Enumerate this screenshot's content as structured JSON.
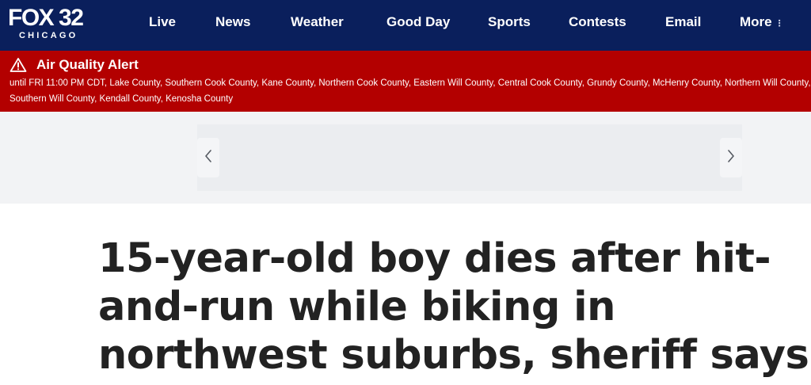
{
  "header": {
    "logo": {
      "main": "FOX 32",
      "sub": "CHICAGO"
    },
    "nav": [
      {
        "label": "Live"
      },
      {
        "label": "News"
      },
      {
        "label": "Weather"
      },
      {
        "label": "Good Day"
      },
      {
        "label": "Sports"
      },
      {
        "label": "Contests"
      },
      {
        "label": "Email"
      },
      {
        "label": "More",
        "icon": "vertical-dots-icon"
      }
    ],
    "colors": {
      "background": "#0a1f5c",
      "text": "#ffffff"
    }
  },
  "alert": {
    "title": "Air Quality Alert",
    "icon": "warning-triangle-icon",
    "details": "until FRI 11:00 PM CDT, Lake County, Southern Cook County, Kane County, Northern Cook County, Eastern Will County, Central Cook County, Grundy County, McHenry County, Northern Will County, Southern Will County, Kendall County, Kenosha County",
    "colors": {
      "background": "#b30000",
      "text": "#ffffff"
    }
  },
  "carousel": {
    "prev_icon": "chevron-left-icon",
    "next_icon": "chevron-right-icon"
  },
  "article": {
    "headline": "15-year-old boy dies after hit-and-run while biking in northwest suburbs, sheriff says"
  }
}
